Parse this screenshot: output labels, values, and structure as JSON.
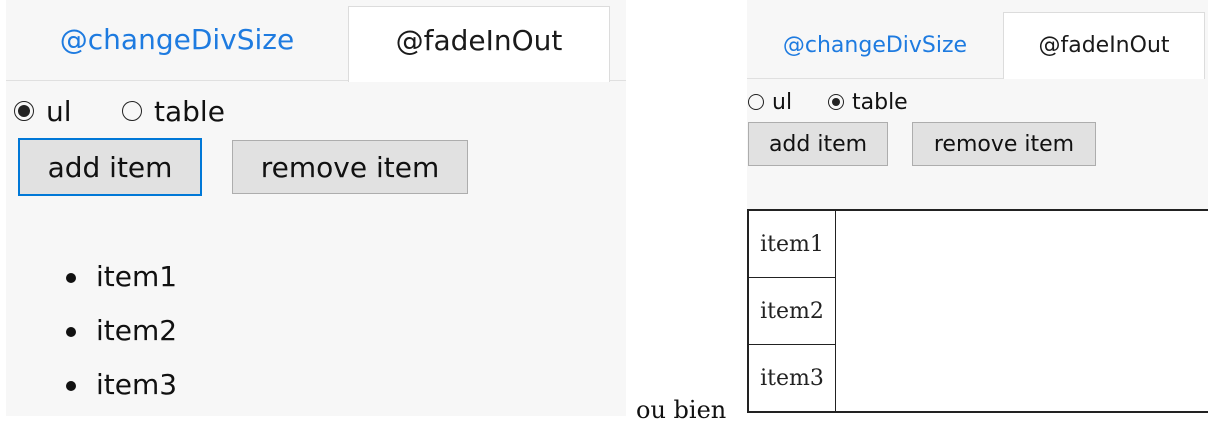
{
  "left": {
    "tabs": [
      {
        "label": "@changeDivSize",
        "active": false
      },
      {
        "label": "@fadeInOut",
        "active": true
      }
    ],
    "radios": [
      {
        "label": "ul",
        "checked": true
      },
      {
        "label": "table",
        "checked": false
      }
    ],
    "buttons": {
      "add_label": "add item",
      "remove_label": "remove item"
    },
    "items": [
      "item1",
      "item2",
      "item3"
    ]
  },
  "right": {
    "tabs": [
      {
        "label": "@changeDivSize",
        "active": false
      },
      {
        "label": "@fadeInOut",
        "active": true
      }
    ],
    "radios": [
      {
        "label": "ul",
        "checked": false
      },
      {
        "label": "table",
        "checked": true
      }
    ],
    "buttons": {
      "add_label": "add item",
      "remove_label": "remove item"
    },
    "table_rows": [
      "item1",
      "item2",
      "item3"
    ]
  },
  "caption": "ou bien",
  "colors": {
    "tab_link": "#1e7be0",
    "focus_border": "#0078d7",
    "button_bg": "#e1e1e1"
  }
}
